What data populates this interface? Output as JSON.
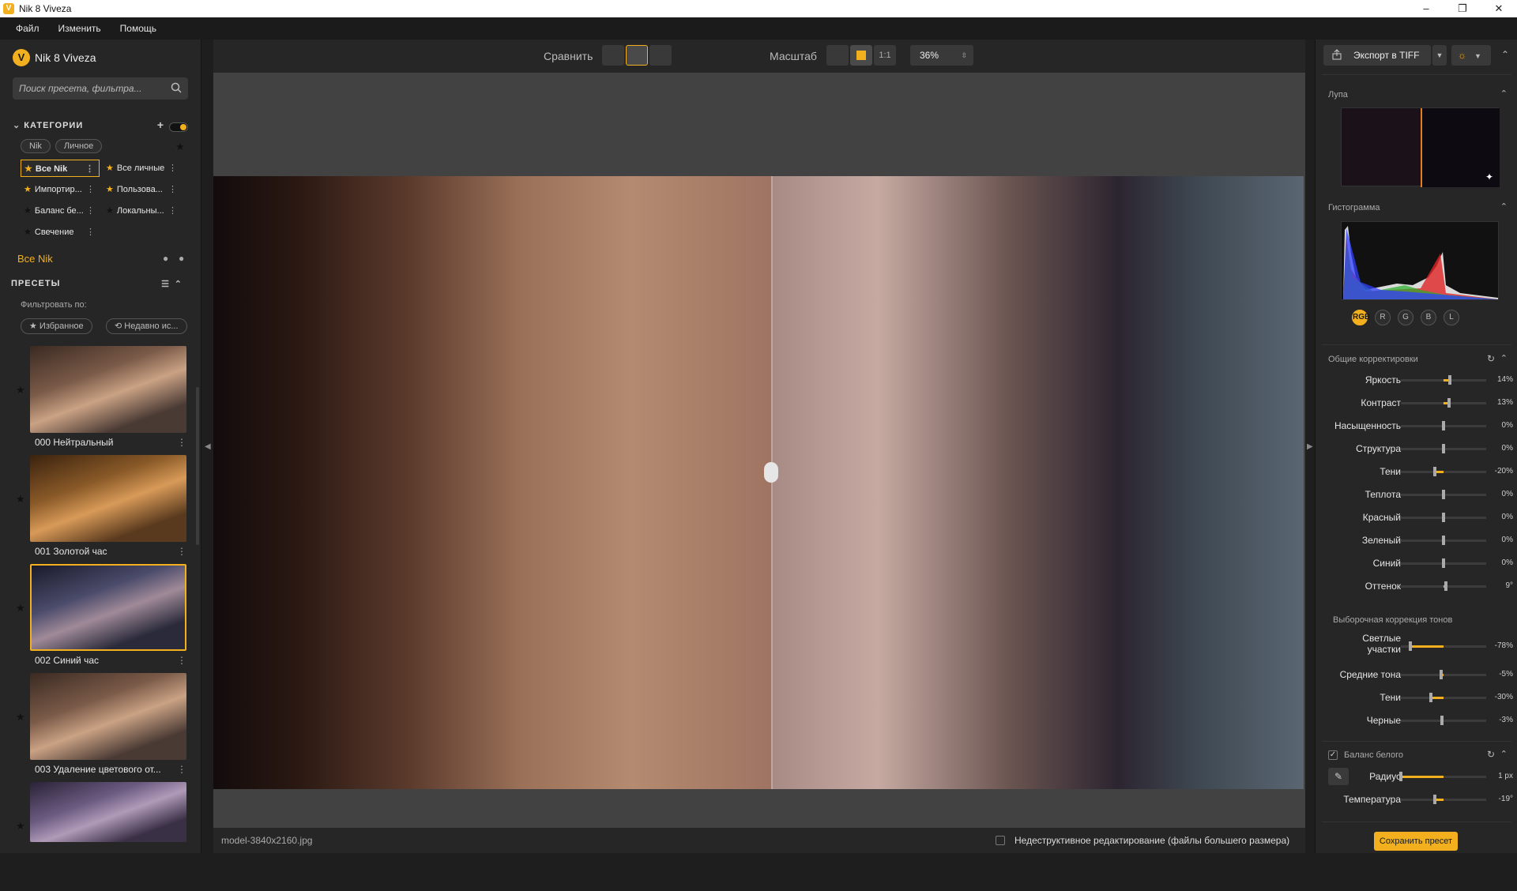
{
  "window": {
    "title": "Nik 8 Viveza"
  },
  "menu": [
    "Файл",
    "Изменить",
    "Помощь"
  ],
  "brand": {
    "name": "Nik 8 Viveza"
  },
  "search": {
    "placeholder": "Поиск пресета, фильтра..."
  },
  "categories": {
    "title": "КАТЕГОРИИ",
    "chips": [
      "Nik",
      "Личное"
    ],
    "items": [
      {
        "label": "Все Nik",
        "starred": true,
        "selected": true
      },
      {
        "label": "Все личные",
        "starred": true
      },
      {
        "label": "Импортир...",
        "starred": true
      },
      {
        "label": "Пользова...",
        "starred": true
      },
      {
        "label": "Баланс бе...",
        "starred": false
      },
      {
        "label": "Локальны...",
        "starred": false
      },
      {
        "label": "Свечение",
        "starred": false
      }
    ],
    "current": "Все Nik"
  },
  "presets": {
    "title": "ПРЕСЕТЫ",
    "filter_by": "Фильтровать по:",
    "filters": [
      "★ Избранное",
      "⟲ Недавно ис..."
    ],
    "items": [
      {
        "label": "000 Нейтральный"
      },
      {
        "label": "001 Золотой час"
      },
      {
        "label": "002 Синий час",
        "selected": true
      },
      {
        "label": "003 Удаление цветового от..."
      }
    ]
  },
  "toolbar": {
    "compare": "Сравнить",
    "scale": "Масштаб",
    "one_to_one": "1:1",
    "zoom": "36%"
  },
  "status": {
    "filename": "model-3840x2160.jpg",
    "nondestructive": "Недеструктивное редактирование (файлы большего размера)"
  },
  "right": {
    "export": "Экспорт в TIFF",
    "loupe": "Лупа",
    "histogram": "Гистограмма",
    "hist_buttons": [
      "RGB",
      "R",
      "G",
      "B",
      "L"
    ],
    "general_title": "Общие корректировки",
    "general": [
      {
        "label": "Яркость",
        "value": "14%",
        "pos": 0.57
      },
      {
        "label": "Контраст",
        "value": "13%",
        "pos": 0.565
      },
      {
        "label": "Насыщенность",
        "value": "0%",
        "pos": 0.5
      },
      {
        "label": "Структура",
        "value": "0%",
        "pos": 0.5
      },
      {
        "label": "Тени",
        "value": "-20%",
        "pos": 0.4
      },
      {
        "label": "Теплота",
        "value": "0%",
        "pos": 0.5
      },
      {
        "label": "Красный",
        "value": "0%",
        "pos": 0.5
      },
      {
        "label": "Зеленый",
        "value": "0%",
        "pos": 0.5
      },
      {
        "label": "Синий",
        "value": "0%",
        "pos": 0.5
      },
      {
        "label": "Оттенок",
        "value": "9°",
        "pos": 0.53
      }
    ],
    "selective_title": "Выборочная коррекция тонов",
    "selective": [
      {
        "label": "Светлые участки",
        "value": "-78%",
        "pos": 0.11
      },
      {
        "label": "Средние тона",
        "value": "-5%",
        "pos": 0.475
      },
      {
        "label": "Тени",
        "value": "-30%",
        "pos": 0.35
      },
      {
        "label": "Черные",
        "value": "-3%",
        "pos": 0.485
      }
    ],
    "wb_title": "Баланс белого",
    "wb": [
      {
        "label": "Радиус",
        "value": "1 px",
        "pos": 0.0
      },
      {
        "label": "Температура",
        "value": "-19°",
        "pos": 0.4
      }
    ],
    "save": "Сохранить пресет"
  },
  "colors": {
    "accent": "#f2b01e"
  }
}
